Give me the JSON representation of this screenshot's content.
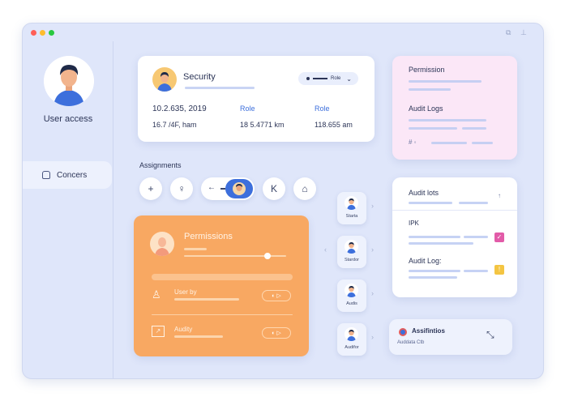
{
  "window": {
    "dots": [
      "#ff5f57",
      "#febc2e",
      "#28c840"
    ],
    "tb_icons": [
      "copy-icon",
      "pin-icon"
    ]
  },
  "sidebar": {
    "title": "User access",
    "item": {
      "label": "Concers",
      "icon": "home-icon"
    }
  },
  "security_card": {
    "title": "Security",
    "dropdown_label": "Role",
    "col1": {
      "value": "10.2.635, 2019",
      "sub": "16.7 /4F, ham"
    },
    "col2": {
      "header": "Role",
      "sub": "18 5.4771 km"
    },
    "col3": {
      "header": "Role",
      "sub": "118.655 am"
    }
  },
  "permission_card": {
    "title": "Permission",
    "audit_title": "Audit Logs",
    "footer": "# ◦"
  },
  "assignments": {
    "label": "Assignments",
    "tools": [
      "plus-icon",
      "user-icon",
      "back-icon",
      "avatar-toggle",
      "k-icon",
      "folder-icon"
    ],
    "tool_glyphs": [
      "+",
      "♀",
      "←",
      "",
      "K",
      "⌂"
    ]
  },
  "permissions_panel": {
    "title": "Permissions",
    "slider_value": 0.82,
    "row1_label": "User by",
    "row2_label": "Audity",
    "accent": "#f8a862"
  },
  "nodes": [
    {
      "label": "Starta"
    },
    {
      "label": "Stardor"
    },
    {
      "label": "Audis"
    },
    {
      "label": "Audifor"
    }
  ],
  "audit_card": {
    "title": "Audit lots",
    "mid_label": "IPK",
    "sub_title": "Audit Log:",
    "arrow": "↑"
  },
  "bottom_card": {
    "title": "Assifintios",
    "sub": "Auddata Ctb",
    "action_icon": "collapse-icon"
  }
}
